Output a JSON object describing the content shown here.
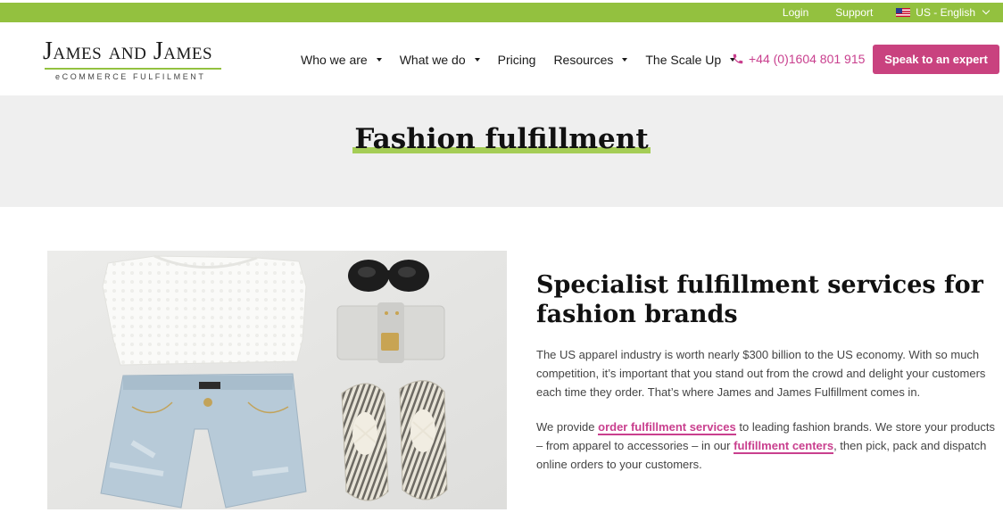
{
  "topbar": {
    "login": "Login",
    "support": "Support",
    "language": "US - English",
    "flag_icon": "us-flag-icon"
  },
  "header": {
    "logo": {
      "main_part1": "J",
      "main_part2": "AMES",
      "main_and": "AND",
      "main_part3": "J",
      "main_part4": "AMES",
      "sub": "eCOMMERCE FULFILMENT"
    },
    "nav": [
      {
        "label": "Who we are",
        "has_dropdown": true
      },
      {
        "label": "What we do",
        "has_dropdown": true
      },
      {
        "label": "Pricing",
        "has_dropdown": false
      },
      {
        "label": "Resources",
        "has_dropdown": true
      },
      {
        "label": "The Scale Up",
        "has_dropdown": true
      }
    ],
    "phone": "+44 (0)1604 801 915",
    "cta": "Speak to an expert"
  },
  "hero": {
    "title": "Fashion fulfillment"
  },
  "main": {
    "heading": "Specialist fulfillment services for fashion brands",
    "para1": "The US apparel industry is worth nearly $300 billion to the US economy. With so much competition, it’s important that you stand out from the crowd and delight your customers each time they order. That’s where James and James Fulfillment comes in.",
    "para2_a": "We provide ",
    "para2_link1": "order fulfillment services",
    "para2_b": " to leading fashion brands. We store your products – from apparel to accessories  – in our ",
    "para2_link2": "fulfillment centers",
    "para2_c": ", then pick, pack and dispatch online orders to your customers."
  },
  "colors": {
    "accent_green": "#93c13f",
    "brand_pink": "#c9427f",
    "hero_bg": "#efefef"
  }
}
